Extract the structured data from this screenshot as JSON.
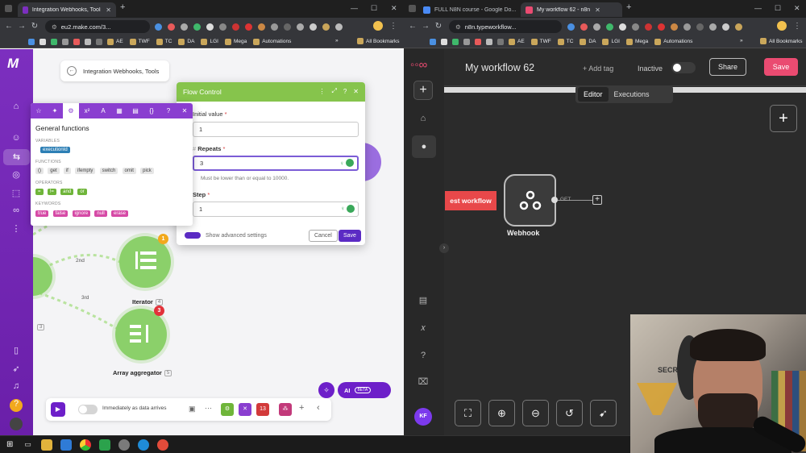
{
  "left_browser": {
    "tab_title": "Integration Webhooks, Tools | Make",
    "url": "eu2.make.com/3...",
    "bookmarks": [
      "AE",
      "TWF",
      "TC",
      "DA",
      "LGI",
      "Mega",
      "Automations"
    ],
    "all_bookmarks": "All Bookmarks"
  },
  "make": {
    "breadcrumb": "Integration Webhooks, Tools",
    "modules": [
      {
        "label": "Iterator",
        "num": "4",
        "badge": "1"
      },
      {
        "label": "Array aggregator",
        "num": "5",
        "badge": "3"
      }
    ],
    "router_num": "3",
    "routes": [
      "2nd",
      "3rd"
    ],
    "flow_control": {
      "title": "Flow Control",
      "initial_value_label": "Initial value",
      "initial_value": "1",
      "repeats_label": "Repeats",
      "repeats_value": "3",
      "repeats_hint": "Must be lower than or equal to 10000.",
      "step_label": "Step",
      "step_value": "1",
      "advanced_label": "Show advanced settings",
      "cancel": "Cancel",
      "save": "Save"
    },
    "functions_popover": {
      "title": "General functions",
      "variables_label": "VARIABLES",
      "variables": [
        "executionId"
      ],
      "functions_label": "FUNCTIONS",
      "functions": [
        "()",
        "get",
        "if",
        "ifempty",
        "switch",
        "omit",
        "pick"
      ],
      "operators_label": "OPERATORS",
      "operators": [
        "=",
        "!=",
        "and",
        "or"
      ],
      "keywords_label": "KEYWORDS",
      "keywords": [
        "true",
        "false",
        "ignore",
        "null",
        "erase"
      ]
    },
    "bottom_bar": {
      "schedule_label": "Immediately as data arrives",
      "badge_num": "13"
    },
    "ai_label": "AI",
    "beta": "BETA"
  },
  "right_browser": {
    "tabs": [
      "FULL N8N course - Google Do...",
      "My workflow 62 - n8n"
    ],
    "url": "n8n.typeworkflow...",
    "bookmarks": [
      "AE",
      "TWF",
      "TC",
      "DA",
      "LGI",
      "Mega",
      "Automations"
    ],
    "all_bookmarks": "All Bookmarks"
  },
  "n8n": {
    "workflow_title": "My workflow 62",
    "add_tag": "+ Add tag",
    "status": "Inactive",
    "share": "Share",
    "save": "Save",
    "tab_editor": "Editor",
    "tab_executions": "Executions",
    "test_workflow": "est workflow",
    "node_label": "Webhook",
    "connector_label": "GET",
    "avatar_initials": "KF"
  },
  "colors": {
    "make_purple": "#6d1fc9",
    "make_green": "#8bd06a",
    "n8n_accent": "#ea4b71"
  }
}
